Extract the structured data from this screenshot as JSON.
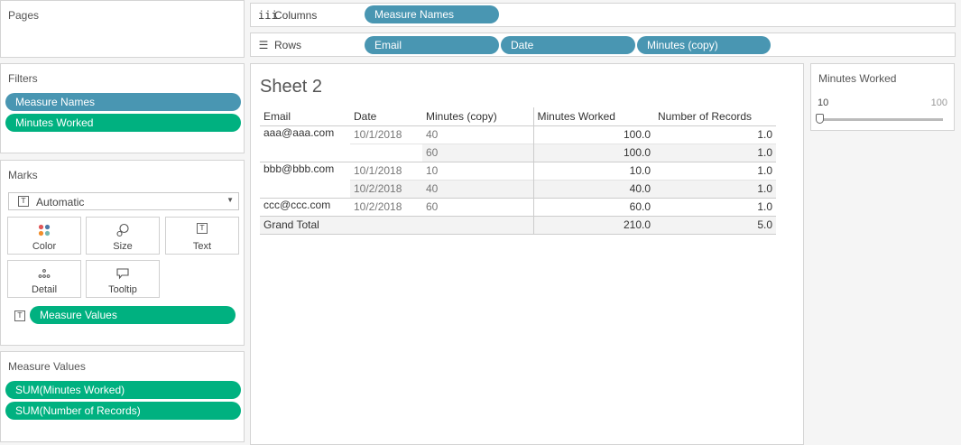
{
  "pages": {
    "title": "Pages"
  },
  "columns_shelf": {
    "label": "Columns",
    "pills": [
      "Measure Names"
    ]
  },
  "rows_shelf": {
    "label": "Rows",
    "pills": [
      "Email",
      "Date",
      "Minutes (copy)"
    ]
  },
  "filters": {
    "title": "Filters",
    "pills": [
      "Measure Names",
      "Minutes Worked"
    ]
  },
  "marks": {
    "title": "Marks",
    "type": "Automatic",
    "buttons": [
      "Color",
      "Size",
      "Text",
      "Detail",
      "Tooltip"
    ],
    "text_pill": "Measure Values"
  },
  "measure_values": {
    "title": "Measure Values",
    "pills": [
      "SUM(Minutes Worked)",
      "SUM(Number of Records)"
    ]
  },
  "sheet": {
    "title": "Sheet 2",
    "headers": [
      "Email",
      "Date",
      "Minutes (copy)",
      "Minutes Worked",
      "Number of Records"
    ],
    "groups": [
      {
        "email": "aaa@aaa.com",
        "rows": [
          {
            "date": "10/1/2018",
            "minutes": "40",
            "worked": "100.0",
            "records": "1.0"
          },
          {
            "date": "",
            "minutes": "60",
            "worked": "100.0",
            "records": "1.0"
          }
        ]
      },
      {
        "email": "bbb@bbb.com",
        "rows": [
          {
            "date": "10/1/2018",
            "minutes": "10",
            "worked": "10.0",
            "records": "1.0"
          },
          {
            "date": "10/2/2018",
            "minutes": "40",
            "worked": "40.0",
            "records": "1.0"
          }
        ]
      },
      {
        "email": "ccc@ccc.com",
        "rows": [
          {
            "date": "10/2/2018",
            "minutes": "60",
            "worked": "60.0",
            "records": "1.0"
          }
        ]
      }
    ],
    "grand_total": {
      "label": "Grand Total",
      "worked": "210.0",
      "records": "5.0"
    }
  },
  "slider": {
    "title": "Minutes Worked",
    "min": "10",
    "max": "100",
    "value_fraction": 0
  },
  "colors": {
    "dimension_pill": "#4996b2",
    "measure_pill": "#00b180"
  }
}
